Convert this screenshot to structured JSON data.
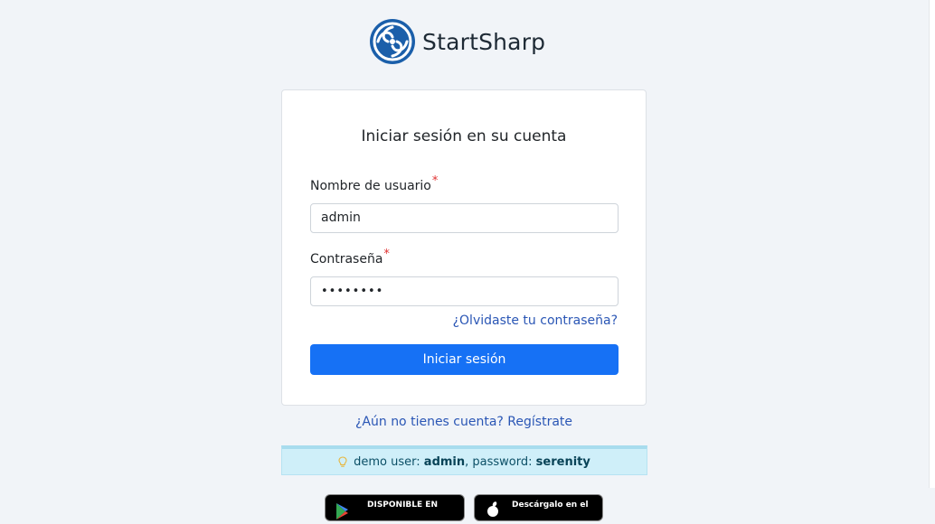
{
  "brand": {
    "name": "StartSharp"
  },
  "login": {
    "title": "Iniciar sesión en su cuenta",
    "username_label": "Nombre de usuario",
    "username_value": "admin",
    "password_label": "Contraseña",
    "password_value": "••••••••",
    "required_mark": "*",
    "forgot_link": "¿Olvidaste tu contraseña?",
    "submit_label": "Iniciar sesión"
  },
  "register_link": "¿Aún no tienes cuenta? Regístrate",
  "demo": {
    "prefix": "demo user:",
    "user": "admin",
    "middle": ", password:",
    "password": "serenity"
  },
  "stores": {
    "google_text": "DISPONIBLE EN",
    "apple_text": "Descárgalo en el"
  },
  "colors": {
    "primary": "#1671f5",
    "link": "#2a56b5",
    "brand_blue": "#1b5faa",
    "alert_bg": "#cfeff9"
  },
  "icons": [
    "startsharp-logo-icon",
    "lightbulb-icon",
    "google-play-icon",
    "apple-icon"
  ]
}
